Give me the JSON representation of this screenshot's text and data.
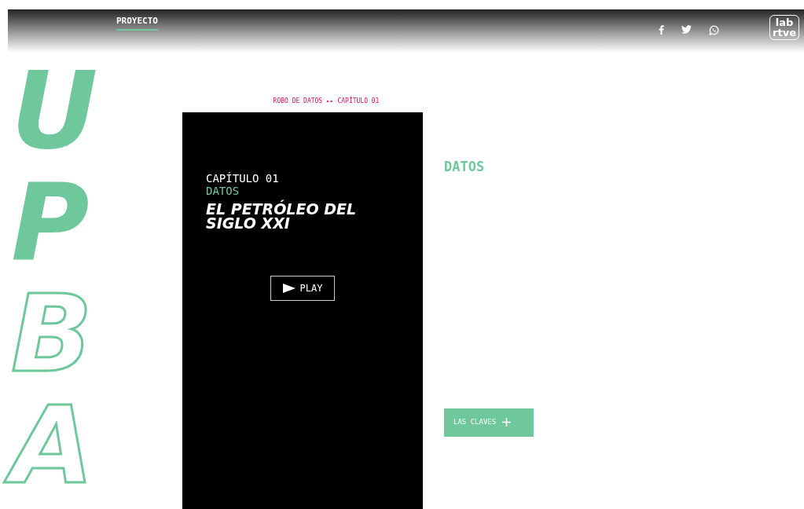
{
  "header": {
    "nav_link": "PROYECTO",
    "logo": [
      "lab",
      "rtve"
    ]
  },
  "side_letters": [
    {
      "text": "U",
      "kind": "filled"
    },
    {
      "text": "P",
      "kind": "filled"
    },
    {
      "text": "B",
      "kind": "outline"
    },
    {
      "text": "A",
      "kind": "outline"
    }
  ],
  "breadcrumb": "ROBO DE DATOS ▸▸ CAPÍTULO 01",
  "chapter": {
    "number": "CAPÍTULO 01",
    "section": "DATOS",
    "title": "EL PETRÓLEO DEL SIGLO XXI",
    "play": "PLAY"
  },
  "content": {
    "heading": "DATOS",
    "button": "LAS CLAVES"
  }
}
